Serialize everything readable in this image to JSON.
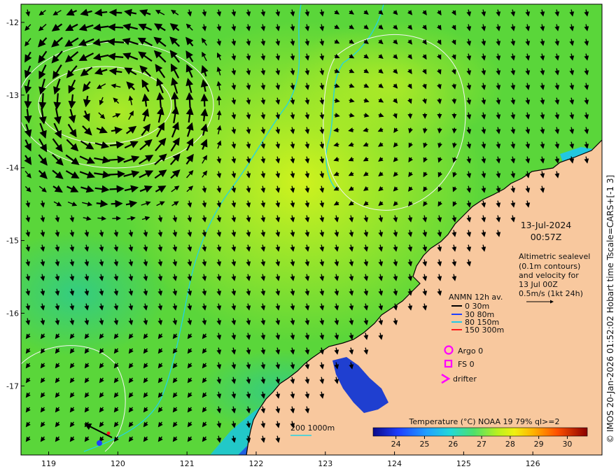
{
  "map": {
    "lon_ticks": [
      "119",
      "120",
      "121",
      "122",
      "123",
      "124",
      "125",
      "126"
    ],
    "lat_ticks": [
      "-12",
      "-13",
      "-14",
      "-15",
      "-16",
      "-17"
    ],
    "lon_range": [
      118.6,
      127.0
    ],
    "lat_range": [
      -11.75,
      -17.95
    ]
  },
  "timestamp": {
    "date": "13-Jul-2024",
    "time": "00:57Z"
  },
  "altimetry": {
    "line1": "Altimetric sealevel",
    "line2": "(0.1m contours)",
    "line3": "and velocity for",
    "line4": "13 Jul 00Z",
    "scale": "0.5m/s (1kt 24h)"
  },
  "legend": {
    "title": "ANMN 12h av.",
    "items": [
      {
        "label": "0 30m",
        "color": "#000000"
      },
      {
        "label": "30 80m",
        "color": "#1f3fff"
      },
      {
        "label": "80 150m",
        "color": "#22c8e6"
      },
      {
        "label": "150 300m",
        "color": "#ff1a1a"
      }
    ],
    "argo": "Argo 0",
    "fs": "FS 0",
    "drifter": "drifter",
    "marker_color": "#ff00ff"
  },
  "isobath": {
    "label": "200  1000m",
    "color": "#22d4e6"
  },
  "colorbar": {
    "title": "Temperature (°C) NOAA 19 79% ql>=2",
    "ticks": [
      "24",
      "25",
      "26",
      "27",
      "28",
      "29",
      "30"
    ],
    "range": [
      23.2,
      30.7
    ]
  },
  "side_caption": "© IMOS 20-Jan-2026 01:52:02 Hobart time Tscale=CARS+[-1 3]",
  "colors": {
    "land": "#f8c89e",
    "sst_warm": "#c8f020",
    "sst_mid": "#5ad63a",
    "sst_cool": "#22c8c8",
    "sst_cold": "#0a2c9c"
  }
}
